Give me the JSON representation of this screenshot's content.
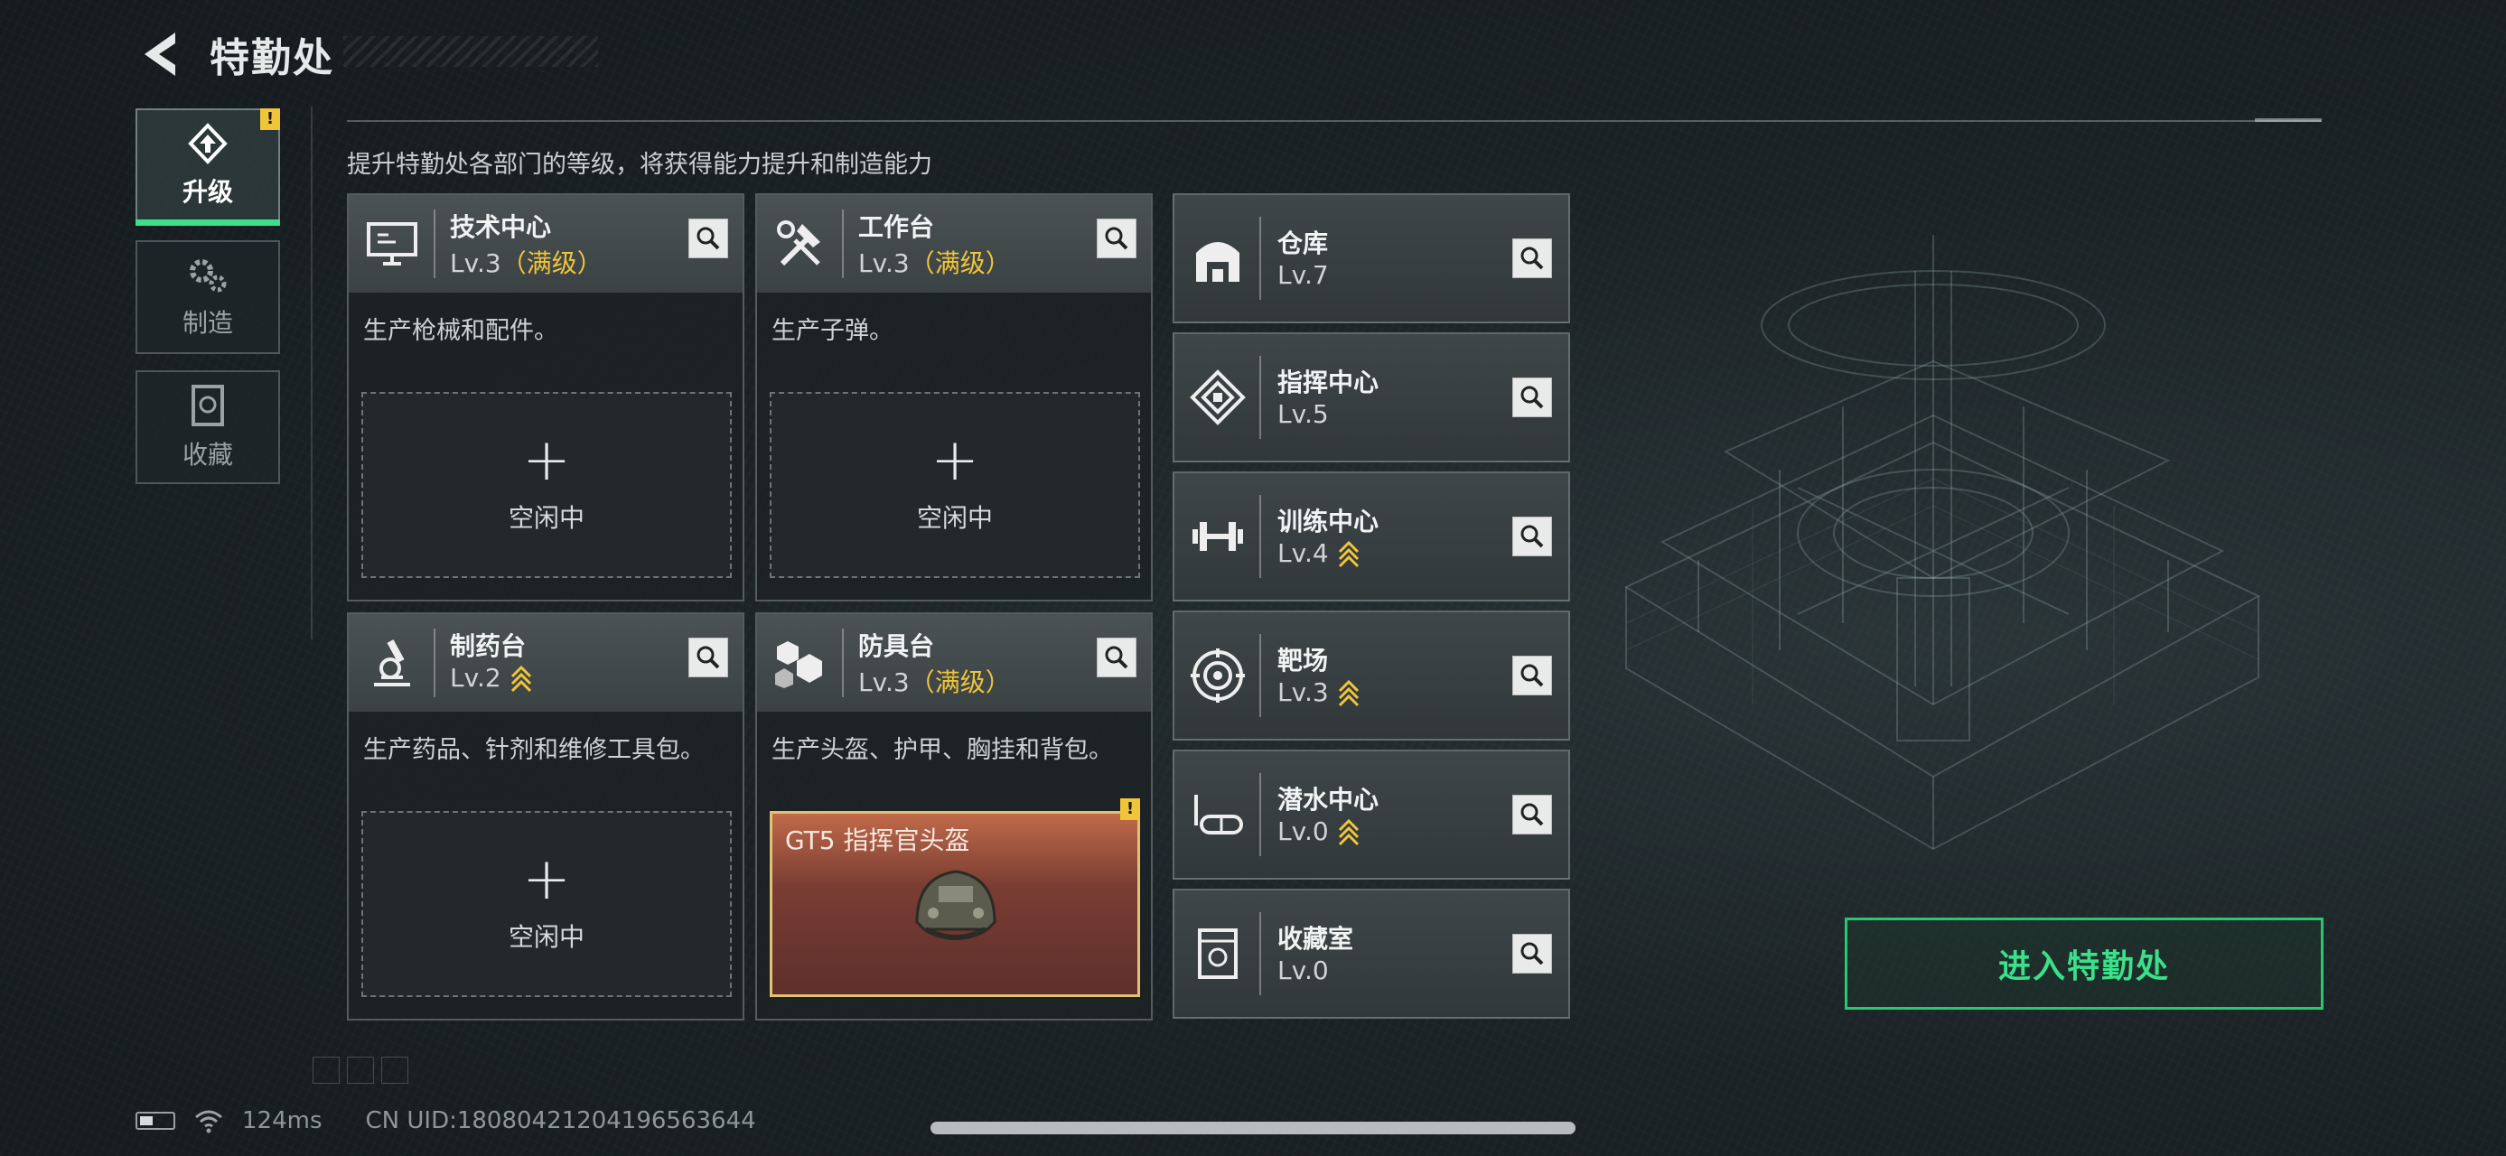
{
  "header": {
    "title": "特勤处",
    "subtitle": "提升特勤处各部门的等级，将获得能力提升和制造能力"
  },
  "tabs": [
    {
      "label": "升级",
      "active": true,
      "alert": "!"
    },
    {
      "label": "制造",
      "active": false
    },
    {
      "label": "收藏",
      "active": false
    }
  ],
  "workshops": [
    {
      "name": "技术中心",
      "level": "Lv.3",
      "max_tag": "（满级）",
      "desc": "生产枪械和配件。",
      "slot_plus": "+",
      "slot_text": "空闲中"
    },
    {
      "name": "工作台",
      "level": "Lv.3",
      "max_tag": "（满级）",
      "desc": "生产子弹。",
      "slot_plus": "+",
      "slot_text": "空闲中"
    },
    {
      "name": "制药台",
      "level": "Lv.2",
      "desc": "生产药品、针剂和维修工具包。",
      "slot_plus": "+",
      "slot_text": "空闲中",
      "upgradable": true
    },
    {
      "name": "防具台",
      "level": "Lv.3",
      "max_tag": "（满级）",
      "desc": "生产头盔、护甲、胸挂和背包。",
      "item_name": "GT5 指挥官头盔",
      "item_alert": "!"
    }
  ],
  "departments": [
    {
      "name": "仓库",
      "level": "Lv.7",
      "icon": "warehouse-icon"
    },
    {
      "name": "指挥中心",
      "level": "Lv.5",
      "icon": "command-center-icon"
    },
    {
      "name": "训练中心",
      "level": "Lv.4",
      "icon": "dumbbell-icon",
      "upgradable": true
    },
    {
      "name": "靶场",
      "level": "Lv.3",
      "icon": "target-icon",
      "upgradable": true
    },
    {
      "name": "潜水中心",
      "level": "Lv.0",
      "icon": "diving-mask-icon",
      "upgradable": true
    },
    {
      "name": "收藏室",
      "level": "Lv.0",
      "icon": "collection-icon"
    }
  ],
  "enter_button": "进入特勤处",
  "status": {
    "ping": "124ms",
    "uid": "CN UID:18080421204196563644"
  },
  "colors": {
    "accent_green": "#3be08a",
    "max_level_gold": "#f0c53a",
    "item_frame": "#e3c172"
  }
}
